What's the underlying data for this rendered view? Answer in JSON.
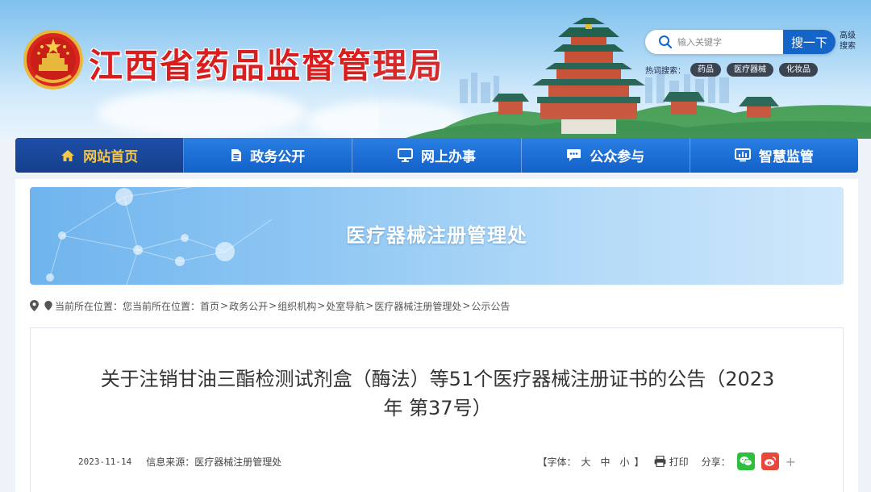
{
  "header": {
    "site_title": "江西省药品监督管理局",
    "search": {
      "placeholder": "输入关键字",
      "button_label": "搜一下"
    },
    "advanced_search_label": "高级搜索",
    "hot_search": {
      "label": "热词搜索：",
      "tags": [
        "药品",
        "医疗器械",
        "化妆品"
      ]
    },
    "emblem_icon": "national-emblem-icon"
  },
  "nav": {
    "items": [
      {
        "label": "网站首页",
        "icon": "home-icon",
        "active": true
      },
      {
        "label": "政务公开",
        "icon": "document-icon",
        "active": false
      },
      {
        "label": "网上办事",
        "icon": "monitor-icon",
        "active": false
      },
      {
        "label": "公众参与",
        "icon": "chat-icon",
        "active": false
      },
      {
        "label": "智慧监管",
        "icon": "dashboard-icon",
        "active": false
      }
    ]
  },
  "banner": {
    "title": "医疗器械注册管理处"
  },
  "breadcrumb": {
    "prefix": "当前所在位置：",
    "prefix2": "您当前所在位置：",
    "items": [
      "首页",
      "政务公开",
      "组织机构",
      "处室导航",
      "医疗器械注册管理处",
      "公示公告"
    ],
    "separator": ">"
  },
  "article": {
    "title_line1": "关于注销甘油三酯检测试剂盒（酶法）等51个医疗器械注册证书的公告（2023",
    "title_line2": "年 第37号）",
    "date": "2023-11-14",
    "source": "信息来源：医疗器械注册管理处",
    "font_label": "【字体：",
    "font_options": [
      "大",
      "中",
      "小"
    ],
    "font_close": "】",
    "print_label": "打印",
    "share_label": "分享："
  },
  "colors": {
    "title_red": "#d81e1e",
    "nav_blue": "#1565c9",
    "nav_active_text": "#f7c646",
    "wechat_green": "#2fbf3f",
    "weibo_red": "#e6493b"
  }
}
